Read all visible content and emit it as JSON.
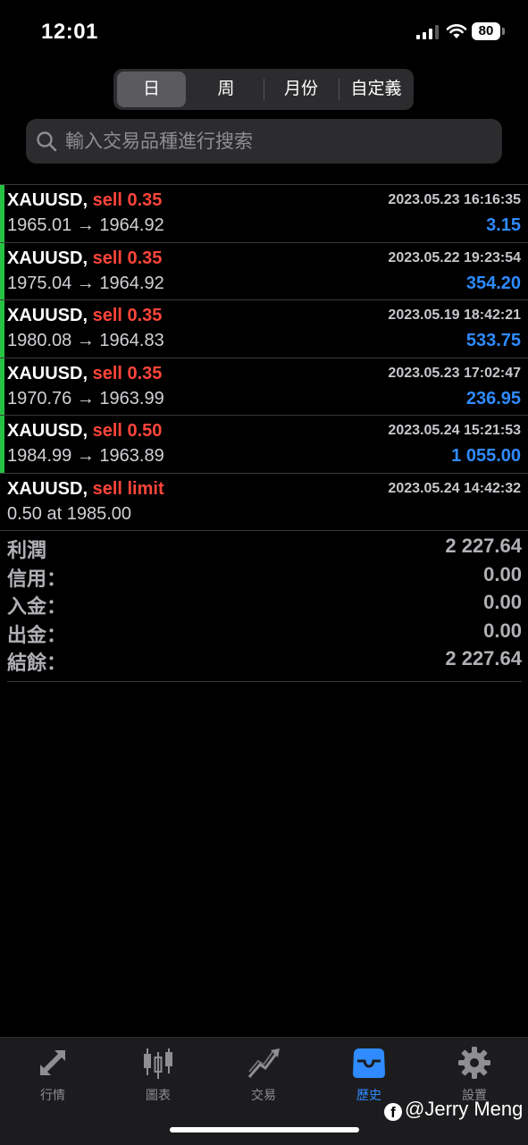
{
  "status_bar": {
    "time": "12:01",
    "battery": "80"
  },
  "period_tabs": [
    {
      "label": "日",
      "active": true
    },
    {
      "label": "周",
      "active": false
    },
    {
      "label": "月份",
      "active": false
    },
    {
      "label": "自定義",
      "active": false
    }
  ],
  "search": {
    "placeholder": "輸入交易品種進行搜索"
  },
  "deals": [
    {
      "symbol": "XAUUSD,",
      "type": "sell 0.35",
      "datetime": "2023.05.23 16:16:35",
      "prices": "1965.01 → 1964.92",
      "profit": "3.15"
    },
    {
      "symbol": "XAUUSD,",
      "type": "sell 0.35",
      "datetime": "2023.05.22 19:23:54",
      "prices": "1975.04 → 1964.92",
      "profit": "354.20"
    },
    {
      "symbol": "XAUUSD,",
      "type": "sell 0.35",
      "datetime": "2023.05.19 18:42:21",
      "prices": "1980.08 → 1964.83",
      "profit": "533.75"
    },
    {
      "symbol": "XAUUSD,",
      "type": "sell 0.35",
      "datetime": "2023.05.23 17:02:47",
      "prices": "1970.76 → 1963.99",
      "profit": "236.95"
    },
    {
      "symbol": "XAUUSD,",
      "type": "sell 0.50",
      "datetime": "2023.05.24 15:21:53",
      "prices": "1984.99 → 1963.89",
      "profit": "1 055.00"
    },
    {
      "symbol": "XAUUSD,",
      "type": "sell limit",
      "datetime": "2023.05.24 14:42:32",
      "prices": "0.50 at 1985.00",
      "profit": ""
    }
  ],
  "summary": [
    {
      "label": "利潤",
      "value": "2 227.64"
    },
    {
      "label": "信用：",
      "value": "0.00"
    },
    {
      "label": "入金：",
      "value": "0.00"
    },
    {
      "label": "出金：",
      "value": "0.00"
    },
    {
      "label": "結餘：",
      "value": "2 227.64"
    }
  ],
  "tab_bar": [
    {
      "label": "行情",
      "icon": "quotes-arrows-icon",
      "active": false
    },
    {
      "label": "圖表",
      "icon": "candlestick-chart-icon",
      "active": false
    },
    {
      "label": "交易",
      "icon": "trade-trend-icon",
      "active": false
    },
    {
      "label": "歷史",
      "icon": "history-tray-icon",
      "active": true
    },
    {
      "label": "設置",
      "icon": "gear-icon",
      "active": false
    }
  ],
  "watermark": "@Jerry Meng",
  "colors": {
    "sell": "#ff453a",
    "profit": "#2f8bff",
    "open_marker": "#26c241",
    "active_tab": "#2f8bff"
  }
}
